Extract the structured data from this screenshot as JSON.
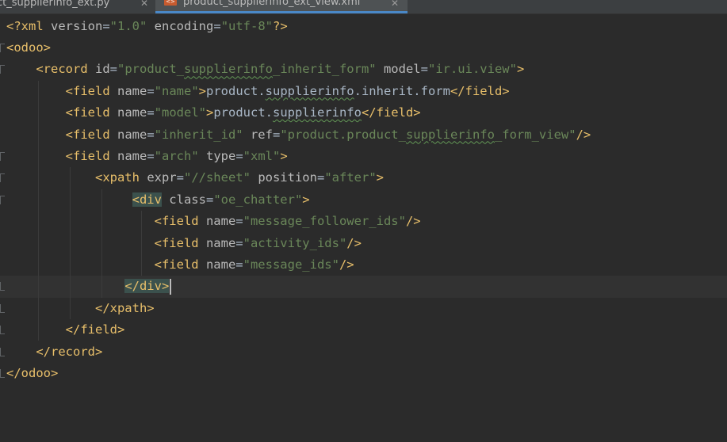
{
  "tabs": [
    {
      "name": "ct_supplierinfo_ext.py",
      "active": false
    },
    {
      "name": "product_supplierinfo_ext_view.xml",
      "active": true
    }
  ],
  "colors": {
    "background": "#2b2b2b",
    "tag": "#e8bf6a",
    "attr": "#bababa",
    "string": "#6a8759",
    "punct": "#cc7832",
    "active_tab_underline": "#4a88c7"
  },
  "editor": {
    "lines": [
      {
        "indent": 0,
        "tokens": [
          [
            "t",
            "<?xml "
          ],
          [
            "a",
            "version"
          ],
          [
            "x",
            "="
          ],
          [
            "v",
            "\"1.0\""
          ],
          [
            "a",
            " encoding"
          ],
          [
            "x",
            "="
          ],
          [
            "v",
            "\"utf-8\""
          ],
          [
            "t",
            "?>"
          ]
        ]
      },
      {
        "indent": 0,
        "tokens": [
          [
            "t",
            "<odoo>"
          ]
        ]
      },
      {
        "indent": 4,
        "tokens": [
          [
            "t",
            "<record "
          ],
          [
            "a",
            "id"
          ],
          [
            "x",
            "="
          ],
          [
            "v",
            "\"product_"
          ],
          [
            "vs",
            "supplierinfo"
          ],
          [
            "v",
            "_inherit_form\""
          ],
          [
            "a",
            " model"
          ],
          [
            "x",
            "="
          ],
          [
            "v",
            "\"ir.ui.view\""
          ],
          [
            "t",
            ">"
          ]
        ]
      },
      {
        "indent": 8,
        "tokens": [
          [
            "t",
            "<field "
          ],
          [
            "a",
            "name"
          ],
          [
            "x",
            "="
          ],
          [
            "v",
            "\"name\""
          ],
          [
            "t",
            ">"
          ],
          [
            "x",
            "product."
          ],
          [
            "xs",
            "supplierinfo"
          ],
          [
            "x",
            ".inherit.form"
          ],
          [
            "t",
            "</field>"
          ]
        ]
      },
      {
        "indent": 8,
        "tokens": [
          [
            "t",
            "<field "
          ],
          [
            "a",
            "name"
          ],
          [
            "x",
            "="
          ],
          [
            "v",
            "\"model\""
          ],
          [
            "t",
            ">"
          ],
          [
            "x",
            "product."
          ],
          [
            "xs",
            "supplierinfo"
          ],
          [
            "t",
            "</field>"
          ]
        ]
      },
      {
        "indent": 8,
        "tokens": [
          [
            "t",
            "<field "
          ],
          [
            "a",
            "name"
          ],
          [
            "x",
            "="
          ],
          [
            "v",
            "\"inherit_id\""
          ],
          [
            "a",
            " ref"
          ],
          [
            "x",
            "="
          ],
          [
            "v",
            "\"product.product_"
          ],
          [
            "vs",
            "supplierinfo"
          ],
          [
            "v",
            "_form_view\""
          ],
          [
            "t",
            "/>"
          ]
        ]
      },
      {
        "indent": 8,
        "tokens": [
          [
            "t",
            "<field "
          ],
          [
            "a",
            "name"
          ],
          [
            "x",
            "="
          ],
          [
            "v",
            "\"arch\""
          ],
          [
            "a",
            " type"
          ],
          [
            "x",
            "="
          ],
          [
            "v",
            "\"xml\""
          ],
          [
            "t",
            ">"
          ]
        ]
      },
      {
        "indent": 12,
        "tokens": [
          [
            "t",
            "<xpath "
          ],
          [
            "a",
            "expr"
          ],
          [
            "x",
            "="
          ],
          [
            "v",
            "\"//sheet\""
          ],
          [
            "a",
            " position"
          ],
          [
            "x",
            "="
          ],
          [
            "v",
            "\"after\""
          ],
          [
            "t",
            ">"
          ]
        ]
      },
      {
        "indent": 17,
        "tokens": [
          [
            "th",
            "<div"
          ],
          [
            "a",
            " class"
          ],
          [
            "x",
            "="
          ],
          [
            "v",
            "\"oe_chatter\""
          ],
          [
            "t",
            ">"
          ]
        ]
      },
      {
        "indent": 20,
        "tokens": [
          [
            "t",
            "<field "
          ],
          [
            "a",
            "name"
          ],
          [
            "x",
            "="
          ],
          [
            "v",
            "\"message_follower_ids\""
          ],
          [
            "t",
            "/>"
          ]
        ]
      },
      {
        "indent": 20,
        "tokens": [
          [
            "t",
            "<field "
          ],
          [
            "a",
            "name"
          ],
          [
            "x",
            "="
          ],
          [
            "v",
            "\"activity_ids\""
          ],
          [
            "t",
            "/>"
          ]
        ]
      },
      {
        "indent": 20,
        "tokens": [
          [
            "t",
            "<field "
          ],
          [
            "a",
            "name"
          ],
          [
            "x",
            "="
          ],
          [
            "v",
            "\"message_ids\""
          ],
          [
            "t",
            "/>"
          ]
        ]
      },
      {
        "indent": 16,
        "caret": true,
        "tokens": [
          [
            "th",
            "</div>"
          ]
        ]
      },
      {
        "indent": 12,
        "tokens": [
          [
            "t",
            "</xpath>"
          ]
        ]
      },
      {
        "indent": 8,
        "tokens": [
          [
            "t",
            "</field>"
          ]
        ]
      },
      {
        "indent": 4,
        "tokens": [
          [
            "t",
            "</record>"
          ]
        ]
      },
      {
        "indent": 0,
        "tokens": [
          [
            "t",
            "</odoo>"
          ]
        ]
      }
    ]
  }
}
